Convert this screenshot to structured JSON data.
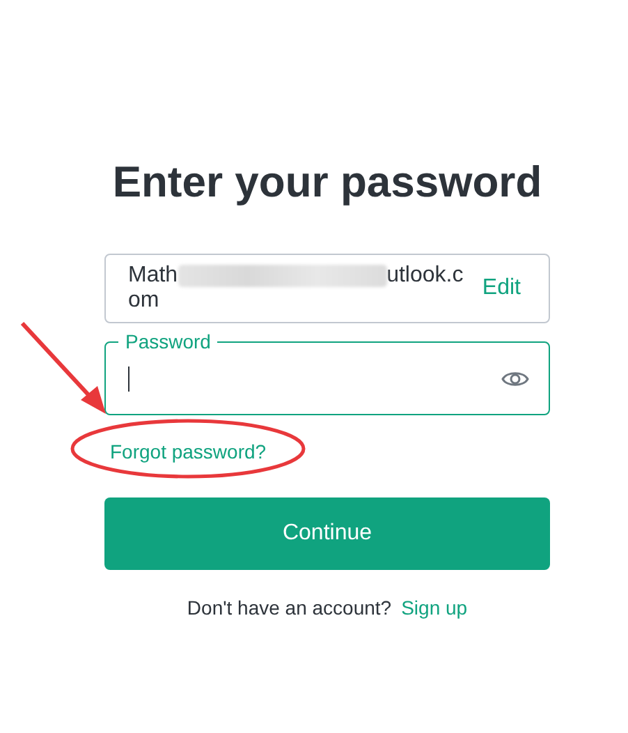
{
  "title": "Enter your password",
  "email": {
    "line_1_start": "Math",
    "line_1_end": "utlook.c",
    "line_2": "om",
    "action": "Edit"
  },
  "password": {
    "label": "Password",
    "focused": true
  },
  "forgot_link": "Forgot password?",
  "continue_button": "Continue",
  "signup": {
    "prompt": "Don't have an account?",
    "link": "Sign up"
  }
}
